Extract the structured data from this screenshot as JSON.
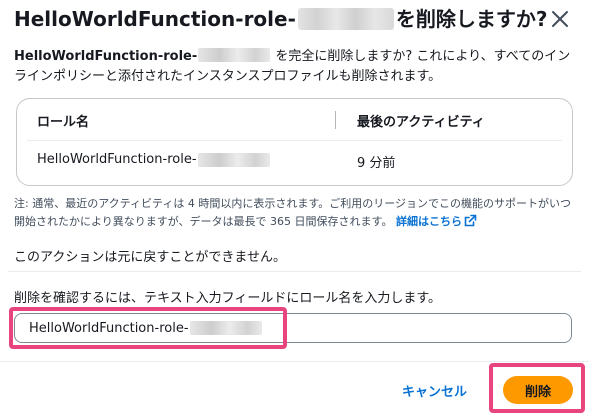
{
  "dialog": {
    "title_prefix": "HelloWorldFunction-role-",
    "title_suffix": "を削除しますか?",
    "close_icon": "close-icon"
  },
  "description": {
    "role_name": "HelloWorldFunction-role-",
    "text_line1": " を完全に削除しますか? これにより、すべてのイン",
    "text_line2": "ラインポリシーと添付されたインスタンスプロファイルも削除されます。"
  },
  "table": {
    "headers": [
      "ロール名",
      "最後のアクティビティ"
    ],
    "rows": [
      {
        "role": "HelloWorldFunction-role-",
        "last_activity": "9 分前"
      }
    ]
  },
  "note": {
    "text": "注: 通常、最近のアクティビティは 4 時間以内に表示されます。ご利用のリージョンでこの機能のサポートがいつ開始されたかにより異なりますが、データは最長で 365 日間保存されます。",
    "link_label": "詳細はこちら",
    "link_icon": "external-link-icon"
  },
  "warning": "このアクションは元に戻すことができません。",
  "confirm": {
    "label": "削除を確認するには、テキスト入力フィールドにロール名を入力します。",
    "value": "HelloWorldFunction-role-"
  },
  "footer": {
    "cancel_label": "キャンセル",
    "delete_label": "削除"
  },
  "colors": {
    "primary_button": "#ff9900",
    "link": "#0972d3",
    "highlight": "#e8457f"
  }
}
